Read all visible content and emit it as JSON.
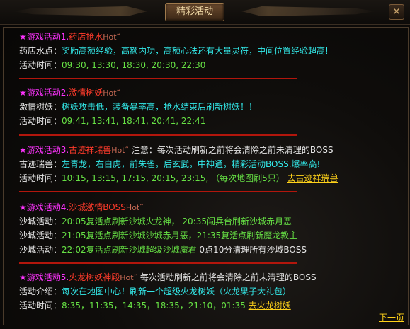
{
  "window": {
    "title": "精彩活动",
    "close_icon": "close-icon",
    "next_label": "下一页"
  },
  "events": [
    {
      "title_prefix": "★游戏活动1.",
      "title_name": "药店抢水",
      "hot": "Hot˜",
      "note": "",
      "rows": [
        {
          "label": "药店水点：",
          "text": "奖励高额经验，高额内功，高额心法还有大量灵符，中间位置经验超高!"
        },
        {
          "label": "活动时间：",
          "text": "09:30, 13:30, 18:30, 20:30, 22:30"
        }
      ]
    },
    {
      "title_prefix": "★游戏活动2.",
      "title_name": "激情树妖",
      "hot": "Hot˜",
      "note": "",
      "rows": [
        {
          "label": "激情树妖：",
          "text": "树妖攻击低，装备暴率高，抢水结束后刷新树妖！！"
        },
        {
          "label": "活动时间：",
          "text": "09:41, 13:41, 18:41, 20:41, 22:41"
        }
      ]
    },
    {
      "title_prefix": "★游戏活动3.",
      "title_name": "古迹祥瑞兽",
      "hot": "Hot˜",
      "note": "注意：每次活动刷新之前将会清除之前未清理的BOSS",
      "rows": [
        {
          "label": "古迹瑞兽：",
          "text": "左青龙，右白虎，前朱雀，后玄武，中神通，精彩活动BOSS.爆率高!"
        },
        {
          "label": "活动时间：",
          "text": "10:15, 13:15, 17:15, 20:15, 23:15, （每次地图刷5只）",
          "link": "去古迹祥瑞兽"
        }
      ]
    },
    {
      "title_prefix": "★游戏活动4.",
      "title_name": "沙城激情BOSS",
      "hot": "Hot˜",
      "note": "",
      "rows": [
        {
          "label": "沙城活动：",
          "text": "20:05复活点刷新沙城火龙神，    20:35闯兵台刷新沙城赤月恶"
        },
        {
          "label": "沙城活动：",
          "text": "21:05复活点刷新沙城沙城赤月恶，21:35复活点刷新魔龙教主"
        },
        {
          "label": "沙城活动：",
          "text": "22:02复活点刷新沙城超级沙城魔君",
          "tail": " 0点10分清理所有沙城BOSS"
        }
      ]
    },
    {
      "title_prefix": "★游戏活动5.",
      "title_name": "火龙树妖神殿",
      "hot": "Hot˜",
      "note": "每次活动刷新之前将会清除之前未清理的BOSS",
      "rows": [
        {
          "label": "活动介绍：",
          "text": "每次在地图中心！刷新一个超级火龙树妖（火龙果子大礼包）"
        },
        {
          "label": "活动时间：",
          "text": "8:35，11:35，14:35，18:35，21:10，01:35",
          "link": "去火龙树妖"
        }
      ]
    }
  ],
  "colors": {
    "title": "#ff33ff",
    "name": "#ff3b2b",
    "label": "#e6e6e6",
    "cyan": "#33eaea",
    "green": "#66e044",
    "link": "#ffd21a",
    "divider": "#b2160c"
  }
}
